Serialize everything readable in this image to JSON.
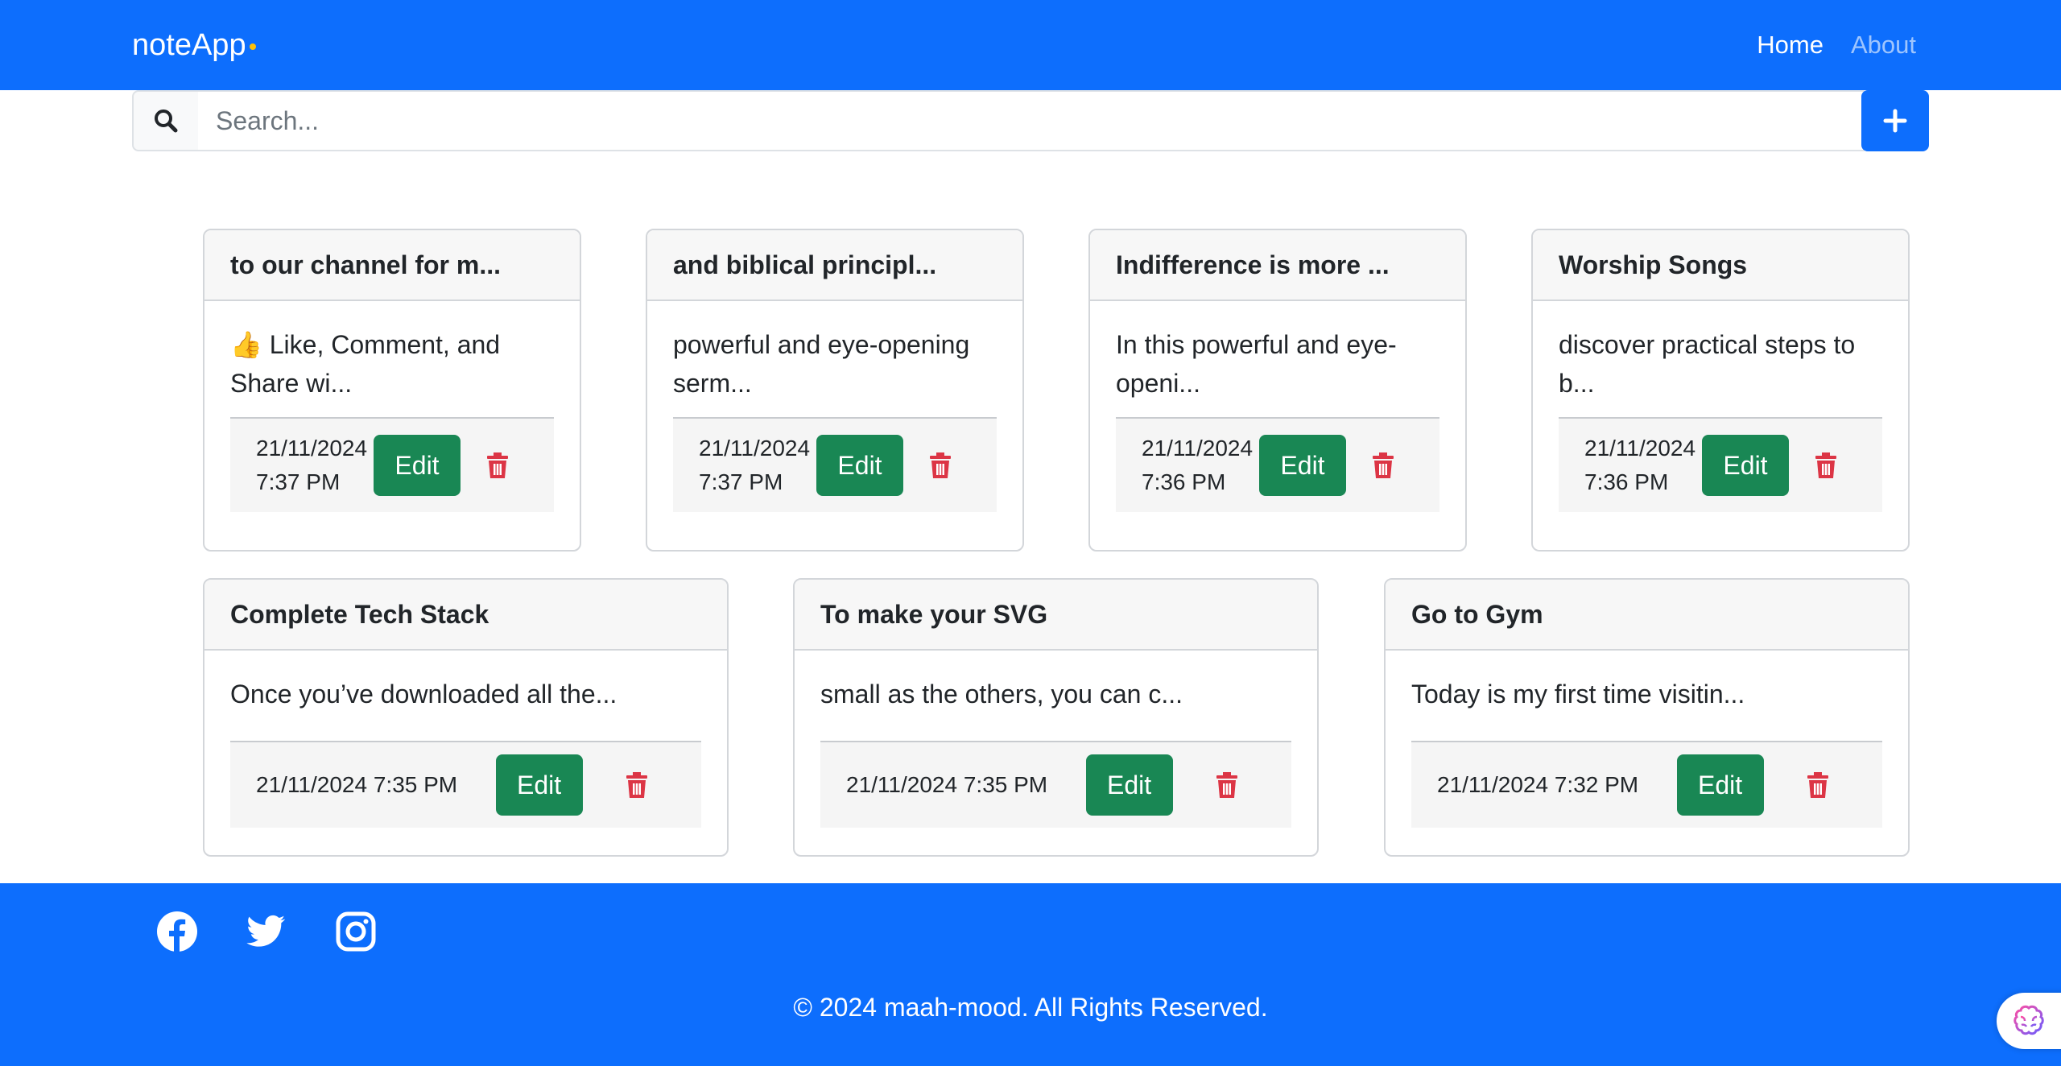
{
  "navbar": {
    "brand": "noteApp",
    "links": [
      {
        "label": "Home",
        "active": true
      },
      {
        "label": "About",
        "active": false
      }
    ]
  },
  "search": {
    "placeholder": "Search...",
    "value": ""
  },
  "add_button_symbol": "+",
  "notes": [
    {
      "title": "to our channel for m...",
      "body": "👍 Like, Comment, and Share wi...",
      "date": "21/11/2024",
      "time": "7:37 PM",
      "timestamp": "21/11/2024 7:37 PM"
    },
    {
      "title": "and biblical principl...",
      "body": "powerful and eye-opening serm...",
      "date": "21/11/2024",
      "time": "7:37 PM",
      "timestamp": "21/11/2024 7:37 PM"
    },
    {
      "title": "Indifference is more ...",
      "body": "In this powerful and eye-openi...",
      "date": "21/11/2024",
      "time": "7:36 PM",
      "timestamp": "21/11/2024 7:36 PM"
    },
    {
      "title": "Worship Songs",
      "body": "discover practical steps to b...",
      "date": "21/11/2024",
      "time": "7:36 PM",
      "timestamp": "21/11/2024 7:36 PM"
    },
    {
      "title": "Complete Tech Stack",
      "body": "Once you’ve downloaded all the...",
      "date": "21/11/2024",
      "time": "7:35 PM",
      "timestamp": "21/11/2024 7:35 PM"
    },
    {
      "title": "To make your SVG",
      "body": "small as the others, you can c...",
      "date": "21/11/2024",
      "time": "7:35 PM",
      "timestamp": "21/11/2024 7:35 PM"
    },
    {
      "title": "Go to Gym",
      "body": "Today is my first time visitin...",
      "date": "21/11/2024",
      "time": "7:32 PM",
      "timestamp": "21/11/2024 7:32 PM"
    }
  ],
  "edit_label": "Edit",
  "footer": {
    "social_icons": [
      "facebook-icon",
      "twitter-icon",
      "instagram-icon"
    ],
    "copyright": "© 2024 maah-mood. All Rights Reserved."
  },
  "colors": {
    "primary": "#0d6efd",
    "success": "#198754",
    "danger": "#dc3545",
    "brand_dot": "#ffc107"
  }
}
